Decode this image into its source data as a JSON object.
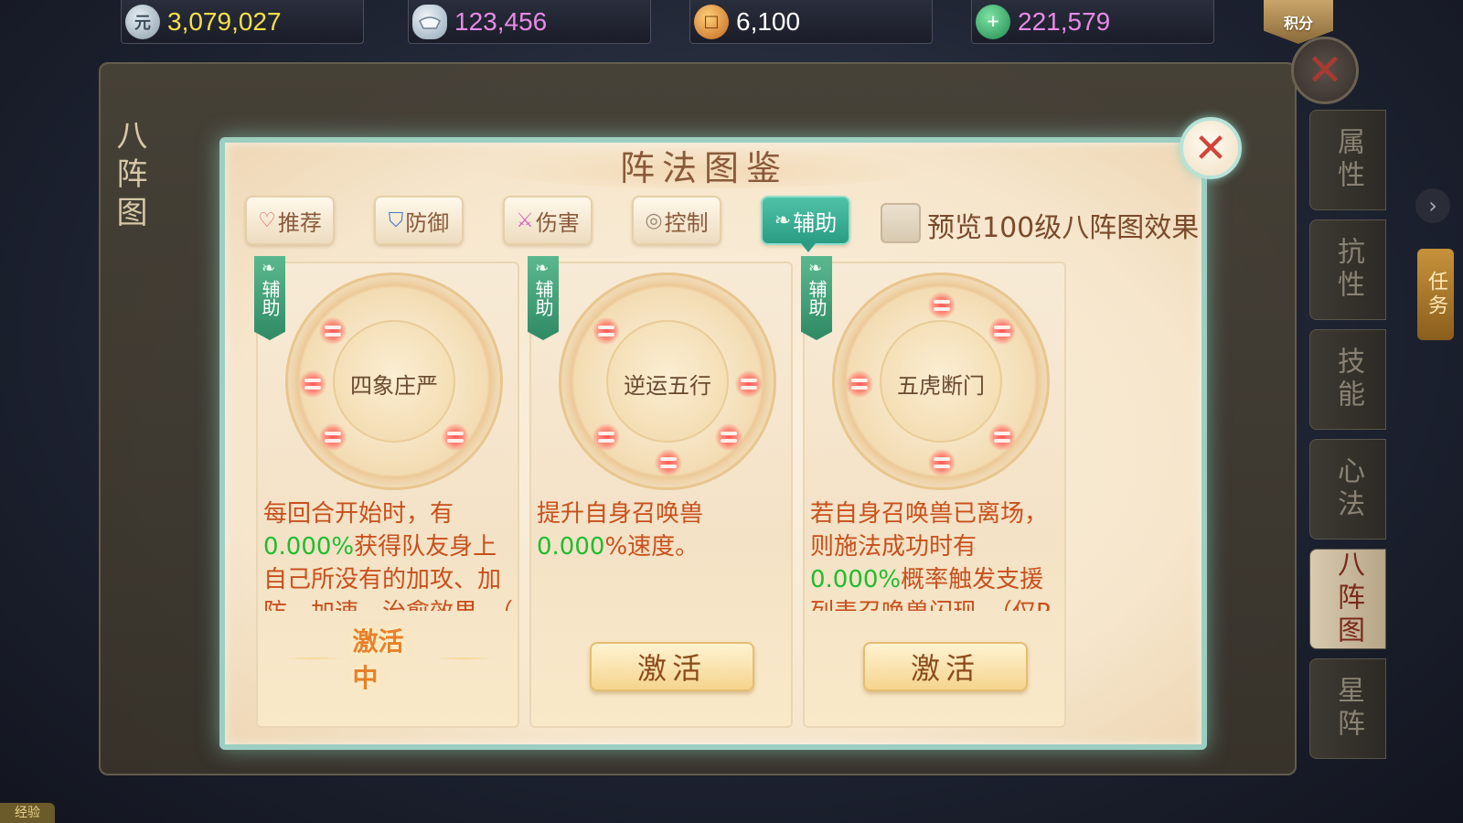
{
  "currencies": [
    {
      "icon": "silver-coin-icon",
      "icon_glyph": "元",
      "value": "3,079,027",
      "color": "#f4e04a"
    },
    {
      "icon": "silver-ingot-icon",
      "icon_glyph": "",
      "value": "123,456",
      "color": "#e88ae8"
    },
    {
      "icon": "copper-coin-icon",
      "icon_glyph": "□",
      "value": "6,100",
      "color": "#ffffff"
    },
    {
      "icon": "jade-add-icon",
      "icon_glyph": "+",
      "value": "221,579",
      "color": "#e88ae8"
    }
  ],
  "score_badge": "积分",
  "background_panel": {
    "title": "八阵图",
    "side_tabs": [
      "属性",
      "抗性",
      "技能",
      "心法",
      "八阵图",
      "星阵"
    ],
    "active_side_tab": 4,
    "task_tag": "任务",
    "exp_label": "经验"
  },
  "dialog": {
    "title": "阵法图鉴",
    "filters": [
      {
        "label": "推荐",
        "icon": "heart-icon",
        "glyph": "♡"
      },
      {
        "label": "防御",
        "icon": "shield-icon",
        "glyph": "⛉"
      },
      {
        "label": "伤害",
        "icon": "sword-icon",
        "glyph": "⚔"
      },
      {
        "label": "控制",
        "icon": "swirl-icon",
        "glyph": "◎"
      },
      {
        "label": "辅助",
        "icon": "leaf-icon",
        "glyph": "❧"
      }
    ],
    "active_filter": 4,
    "preview_label": "预览100级八阵图效果",
    "preview_checked": false,
    "cards": [
      {
        "type": "辅助",
        "name": "四象庄严",
        "desc_pre": "每回合开始时，有",
        "desc_hl": "0.000%",
        "desc_post": "获得队友身上自己所没有的加攻、加防、加速、治愈效果。（",
        "status": "激活中",
        "is_active": true
      },
      {
        "type": "辅助",
        "name": "逆运五行",
        "desc_pre": "提升自身召唤兽",
        "desc_hl": "0.000",
        "desc_post": "%速度。",
        "button": "激活",
        "is_active": false
      },
      {
        "type": "辅助",
        "name": "五虎断门",
        "desc_pre": "若自身召唤兽已离场，则施法成功时有",
        "desc_hl": "0.000%",
        "desc_post": "概率触发支援列表召唤兽闪现。（仅P",
        "button": "激活",
        "is_active": false
      }
    ]
  }
}
